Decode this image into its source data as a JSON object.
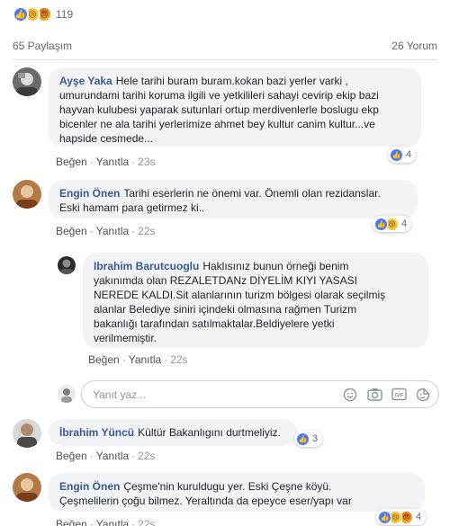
{
  "post": {
    "reaction_count": "119",
    "reaction_icons": [
      "like-icon",
      "sad-icon",
      "angry-icon"
    ],
    "shares": "65 Paylaşım",
    "comments_count": "26 Yorum"
  },
  "colors": {
    "link": "#385898",
    "like": "#4b79f5",
    "bubble": "#f2f3f5"
  },
  "comments": [
    {
      "author": "Ayşe Yaka",
      "lines": [
        "Hele tarihi buram buram.kokan bazi yerler varki ,",
        "umurundami tarihi koruma ilgili ve yetkilileri sahayi cevirip ekip bazi",
        "hayvan kulubesi yaparak sutunlari ortup merdivenlerle boslugu ekp",
        "bicenler ne ala tarihi yerlerimize ahmet bey kultur canim kultur...ve",
        "hapside cesmede..."
      ],
      "like": "Beğen",
      "reply": "Yanıtla",
      "time": "23s",
      "reactions": {
        "icons": [
          "like-icon"
        ],
        "count": "4"
      }
    },
    {
      "author": "Engin Önen",
      "lines": [
        "Tarihi eserlerin ne önemi var. Önemli olan rezidanslar.",
        "Eski hamam para getirmez ki.."
      ],
      "like": "Beğen",
      "reply": "Yanıtla",
      "time": "22s",
      "reactions": {
        "icons": [
          "like-icon",
          "sad-icon"
        ],
        "count": "4"
      }
    },
    {
      "author": "Ibrahim Barutcuoglu",
      "lines": [
        "Haklısınız bunun örneği benim",
        "yakınımda olan REZALETDANz DİYELİM KIYI YASASI",
        "NEREDE KALDI.Sit alanlarının turizm bölgesi olarak seçilmiş",
        "alanlar Belediye siniri içindeki olmasına rağmen Turizm",
        "bakanlığı tarafından satılmaktalar.Beldiyelere yetki",
        "verilmemiştir."
      ],
      "like": "Beğen",
      "reply": "Yanıtla",
      "time": "22s"
    },
    {
      "author": "İbrahim Yüncü",
      "lines": [
        "Kültür Bakanlıgını durtmeliyiz."
      ],
      "like": "Beğen",
      "reply": "Yanıtla",
      "time": "22s",
      "reactions": {
        "icons": [
          "like-icon"
        ],
        "count": "3"
      }
    },
    {
      "author": "Engin Önen",
      "lines": [
        "Çeşme'nin kuruldugu yer. Eski Çeşne köyü.",
        "Çeşmelilerin çoğu bilmez. Yeraltında da epeyce eser/yapı var"
      ],
      "like": "Beğen",
      "reply": "Yanıtla",
      "time": "22s",
      "reactions": {
        "icons": [
          "like-icon",
          "sad-icon",
          "angry-icon"
        ],
        "count": "4"
      }
    }
  ],
  "reply_box": {
    "placeholder": "Yanıt yaz...",
    "icons": [
      "emoji-icon",
      "camera-icon",
      "gif-icon",
      "sticker-icon"
    ]
  }
}
